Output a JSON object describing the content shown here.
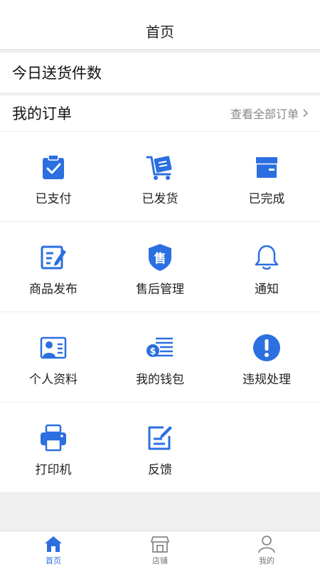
{
  "header": {
    "title": "首页"
  },
  "delivery": {
    "label": "今日送货件数"
  },
  "orders": {
    "label": "我的订单",
    "view_all": "查看全部订单"
  },
  "grid": [
    [
      {
        "label": "已支付",
        "icon": "clipboard-check-icon"
      },
      {
        "label": "已发货",
        "icon": "cart-box-icon"
      },
      {
        "label": "已完成",
        "icon": "box-icon"
      }
    ],
    [
      {
        "label": "商品发布",
        "icon": "edit-document-icon"
      },
      {
        "label": "售后管理",
        "icon": "shield-sell-icon"
      },
      {
        "label": "通知",
        "icon": "bell-icon"
      }
    ],
    [
      {
        "label": "个人资料",
        "icon": "profile-card-icon"
      },
      {
        "label": "我的钱包",
        "icon": "wallet-coin-icon"
      },
      {
        "label": "违规处理",
        "icon": "alert-circle-icon"
      }
    ],
    [
      {
        "label": "打印机",
        "icon": "printer-icon"
      },
      {
        "label": "反馈",
        "icon": "feedback-icon"
      }
    ]
  ],
  "tabs": [
    {
      "label": "首页",
      "icon": "home-icon",
      "active": true
    },
    {
      "label": "店铺",
      "icon": "store-icon",
      "active": false
    },
    {
      "label": "我的",
      "icon": "user-icon",
      "active": false
    }
  ],
  "colors": {
    "accent": "#2b6fe0",
    "background": "#efefef"
  }
}
